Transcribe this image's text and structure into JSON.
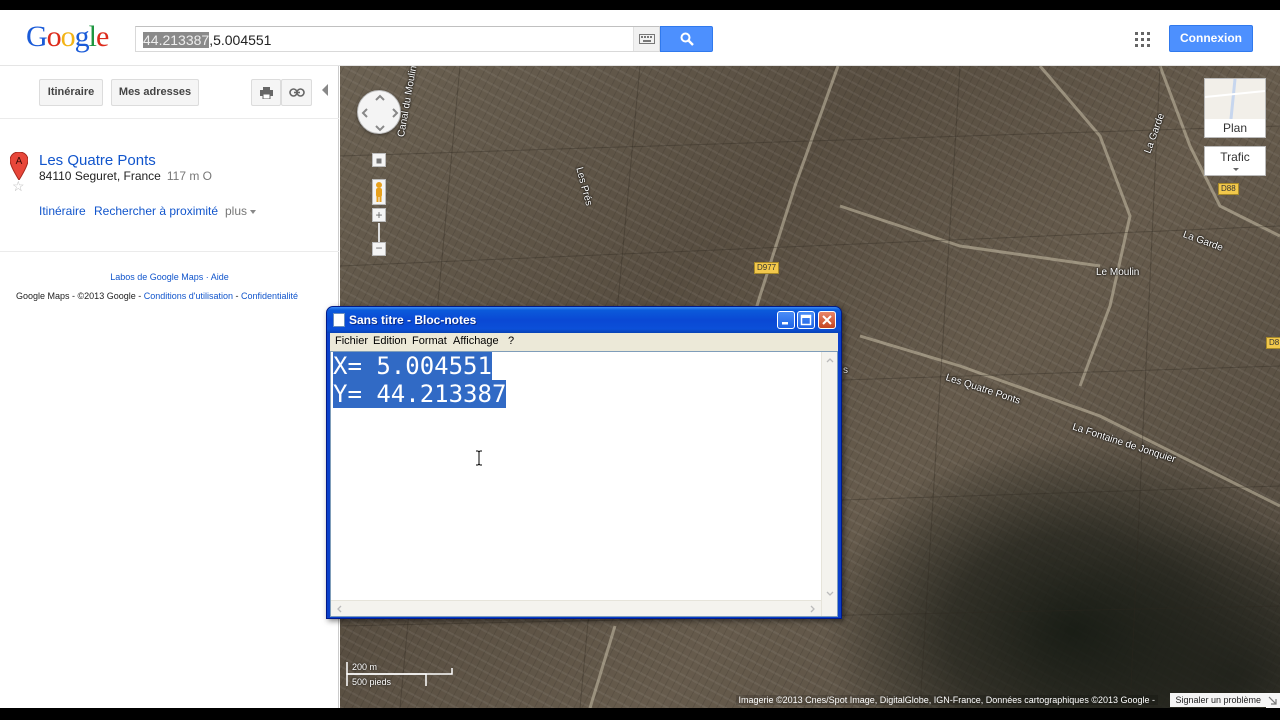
{
  "header": {
    "search_value_selected": "44.213387",
    "search_value_rest": ",5.004551",
    "signin_label": "Connexion"
  },
  "logo": {
    "letters": [
      "G",
      "o",
      "o",
      "g",
      "l",
      "e"
    ],
    "colors": [
      "#1a5bd8",
      "#dd2b1c",
      "#f3b416",
      "#1a5bd8",
      "#1e9640",
      "#dd2b1c"
    ]
  },
  "left_panel": {
    "toolbar": {
      "itineraire_label": "Itinéraire",
      "mes_adresses_label": "Mes adresses"
    },
    "result": {
      "marker_letter": "A",
      "title": "Les Quatre Ponts",
      "address": "84110 Seguret, France",
      "distance": "117 m O",
      "links": {
        "itineraire": "Itinéraire",
        "nearby": "Rechercher à proximité",
        "plus": "plus"
      }
    },
    "footer": {
      "labs": "Labos de Google Maps",
      "sep": " · ",
      "help": "Aide",
      "brand": "Google Maps",
      "copyright": "- ©2013 Google -",
      "terms": "Conditions d'utilisation",
      "dash": " - ",
      "privacy": "Confidentialité"
    }
  },
  "map": {
    "labels": {
      "canal": "Canal du Moulin",
      "les_pres": "Les Prés",
      "la_garde_1": "La Garde",
      "la_garde_2": "La Garde",
      "le_moulin": "Le Moulin",
      "quatre_ponts": "Les Quatre Ponts",
      "fontaine": "La Fontaine de Jonquier",
      "edge_s": "s"
    },
    "shields": {
      "d977": "D977",
      "d88": "D88",
      "d8": "D8"
    },
    "controls": {
      "plan_label": "Plan",
      "trafic_label": "Trafic",
      "zoom_in": "+",
      "zoom_out": "−"
    },
    "scale": {
      "metric": "200 m",
      "imperial": "500 pieds"
    },
    "attribution": "Imagerie ©2013 Cnes/Spot Image, DigitalGlobe, IGN-France, Données cartographiques ©2013 Google -",
    "report_label": "Signaler un problème"
  },
  "notepad": {
    "title": "Sans titre - Bloc-notes",
    "menu": {
      "fichier": "Fichier",
      "edition": "Edition",
      "format": "Format",
      "affichage": "Affichage",
      "help": "?"
    },
    "lines": [
      "X= 5.004551",
      "Y= 44.213387"
    ],
    "selection_color": "#316ac5"
  }
}
